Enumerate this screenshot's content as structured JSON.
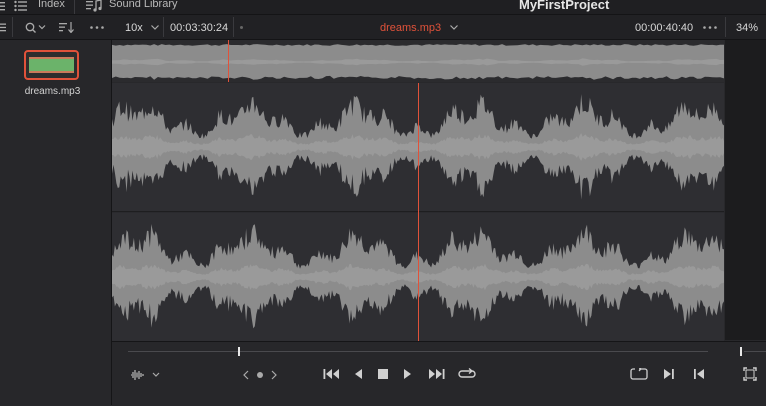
{
  "header": {
    "index_label": "Index",
    "sound_library_label": "Sound Library",
    "project_title": "MyFirstProject"
  },
  "toolbar": {
    "zoom_value": "10x",
    "timecode_left": "00:03:30:24",
    "clip_name": "dreams.mp3",
    "timecode_right": "00:00:40:40",
    "zoom_percent": "34%"
  },
  "media_pool": {
    "clips": [
      {
        "name": "dreams.mp3"
      }
    ]
  },
  "playback": {
    "playhead_fraction": 0.5,
    "overview_playhead_fraction": 0.19,
    "scrub_fraction": 0.19
  },
  "colors": {
    "accent": "#e0523a",
    "playhead": "#e0523a",
    "waveform": "#8c8c8c",
    "clip_thumb": "#6bb36a"
  },
  "icons": {
    "index": "list-icon",
    "sound_library": "music-note-icon",
    "search": "search-icon",
    "sort": "sort-icon",
    "more": "more-icon",
    "waveform_mode": "waveform-icon",
    "prev_next": "prev-next-icon",
    "skip_start": "skip-to-start-icon",
    "step_back": "play-reverse-icon",
    "stop": "stop-icon",
    "play": "play-icon",
    "skip_end": "skip-to-end-icon",
    "loop": "loop-icon",
    "fullscreen": "fullscreen-icon"
  }
}
